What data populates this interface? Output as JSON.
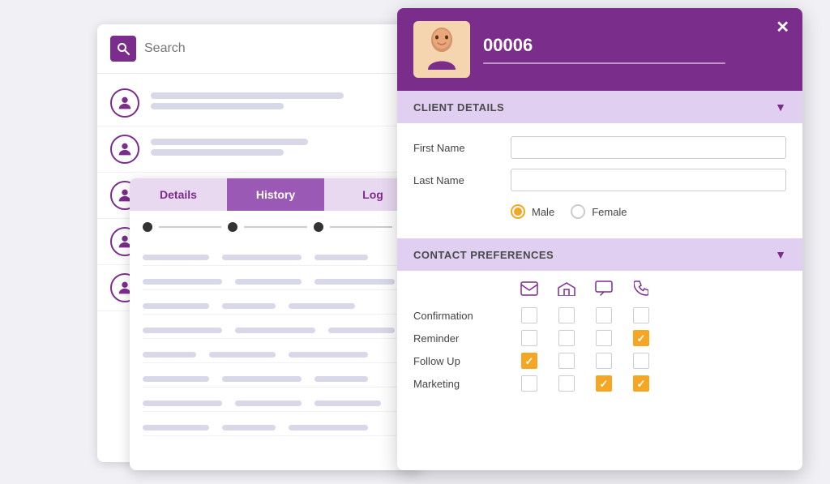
{
  "search": {
    "placeholder": "Search"
  },
  "list": {
    "items": [
      {
        "id": 1
      },
      {
        "id": 2
      },
      {
        "id": 3
      },
      {
        "id": 4
      },
      {
        "id": 5
      }
    ]
  },
  "tabs": {
    "items": [
      {
        "label": "Details",
        "active": false
      },
      {
        "label": "History",
        "active": true
      },
      {
        "label": "Log",
        "active": false
      }
    ]
  },
  "client": {
    "id": "00006",
    "firstName": "",
    "lastName": "",
    "gender": "male"
  },
  "sections": {
    "clientDetails": "CLIENT DETAILS",
    "contactPreferences": "CONTACT PREFERENCES"
  },
  "fields": {
    "firstName": "First Name",
    "lastName": "Last Name",
    "male": "Male",
    "female": "Female"
  },
  "icons": {
    "email": "✉",
    "emailOpen": "✉",
    "chat": "💬",
    "phone": "📞",
    "close": "✕",
    "chevronDown": "▼",
    "search": "🔍"
  },
  "contactRows": [
    {
      "label": "Confirmation",
      "checks": [
        false,
        false,
        false,
        false
      ]
    },
    {
      "label": "Reminder",
      "checks": [
        false,
        false,
        false,
        true
      ]
    },
    {
      "label": "Follow Up",
      "checks": [
        true,
        false,
        false,
        false
      ]
    },
    {
      "label": "Marketing",
      "checks": [
        false,
        false,
        true,
        true
      ]
    }
  ]
}
